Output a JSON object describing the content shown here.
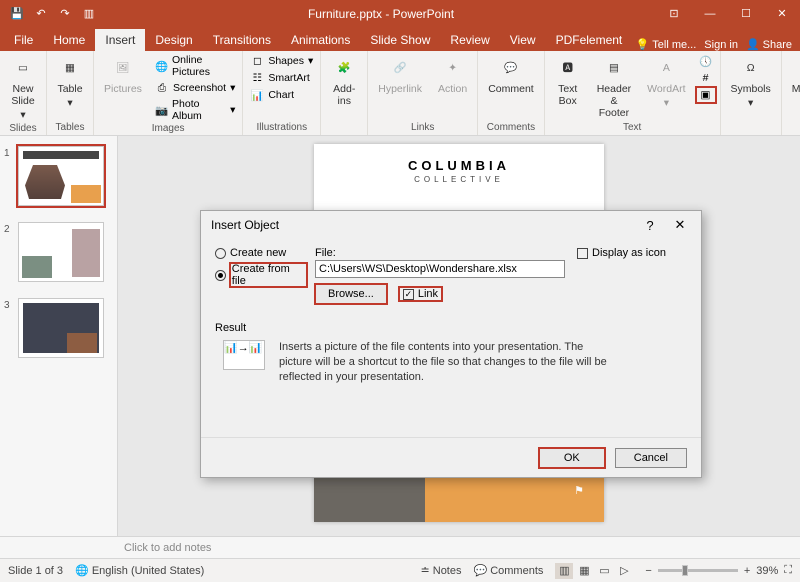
{
  "app": {
    "title": "Furniture.pptx - PowerPoint"
  },
  "tabs": [
    "File",
    "Home",
    "Insert",
    "Design",
    "Transitions",
    "Animations",
    "Slide Show",
    "Review",
    "View",
    "PDFelement"
  ],
  "ribbon_right": {
    "tell": "Tell me...",
    "signin": "Sign in",
    "share": "Share"
  },
  "ribbon": {
    "slides": {
      "label": "Slides",
      "new_slide": "New\nSlide"
    },
    "tables": {
      "label": "Tables",
      "table": "Table"
    },
    "images": {
      "label": "Images",
      "pictures": "Pictures",
      "online": "Online Pictures",
      "screenshot": "Screenshot",
      "album": "Photo Album"
    },
    "illustrations": {
      "label": "Illustrations",
      "shapes": "Shapes",
      "smartart": "SmartArt",
      "chart": "Chart"
    },
    "addins": {
      "label": "",
      "btn": "Add-\nins"
    },
    "links": {
      "label": "Links",
      "hyperlink": "Hyperlink",
      "action": "Action"
    },
    "comments": {
      "label": "Comments",
      "comment": "Comment"
    },
    "text": {
      "label": "Text",
      "textbox": "Text\nBox",
      "header": "Header\n& Footer",
      "wordart": "WordArt"
    },
    "symbols": {
      "label": "",
      "btn": "Symbols"
    },
    "media": {
      "label": "",
      "btn": "Media"
    }
  },
  "slide": {
    "title": "COLUMBIA",
    "subtitle": "COLLECTIVE"
  },
  "dialog": {
    "title": "Insert Object",
    "create_new": "Create new",
    "create_from_file": "Create from file",
    "file_label": "File:",
    "file_value": "C:\\Users\\WS\\Desktop\\Wondershare.xlsx",
    "browse": "Browse...",
    "link": "Link",
    "display_icon": "Display as icon",
    "result_label": "Result",
    "result_text": "Inserts a picture of the file contents into your presentation. The picture will be a shortcut to the file so that changes to the file will be reflected in your presentation.",
    "ok": "OK",
    "cancel": "Cancel"
  },
  "notes": {
    "placeholder": "Click to add notes"
  },
  "status": {
    "slide": "Slide 1 of 3",
    "lang": "English (United States)",
    "notes": "Notes",
    "comments": "Comments",
    "zoom": "39%"
  }
}
